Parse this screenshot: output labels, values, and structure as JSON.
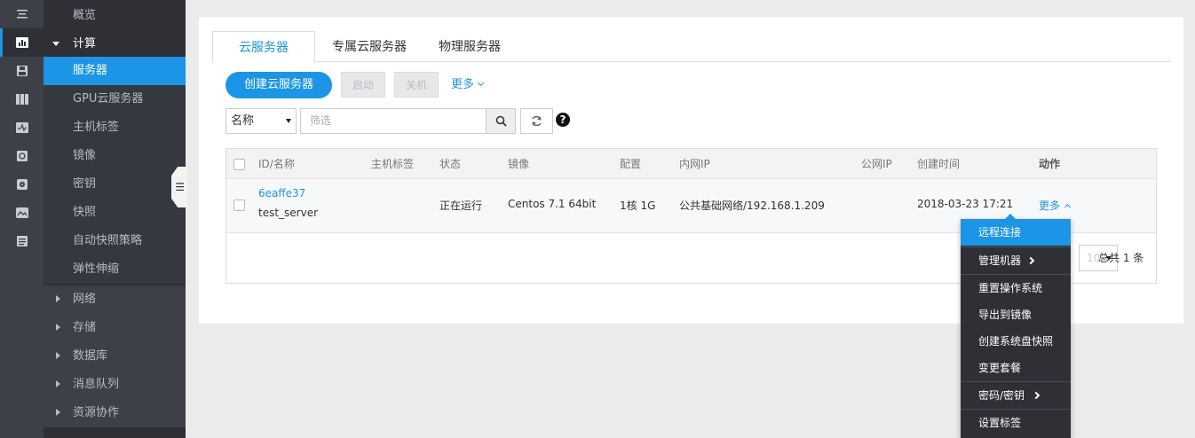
{
  "rail": {
    "icons": [
      "menu-icon",
      "dashboard-icon",
      "save-icon",
      "table-icon",
      "monitor-icon",
      "refresh-box-icon",
      "disk-icon",
      "image-icon",
      "list-icon"
    ]
  },
  "submenu": {
    "overview": "概览",
    "compute_group": "计算",
    "compute_items": [
      "服务器",
      "GPU云服务器",
      "主机标签",
      "镜像",
      "密钥",
      "快照",
      "自动快照策略",
      "弹性伸缩"
    ],
    "collapsed_groups": [
      "网络",
      "存储",
      "数据库",
      "消息队列",
      "资源协作"
    ]
  },
  "tabs": [
    "云服务器",
    "专属云服务器",
    "物理服务器"
  ],
  "toolbar": {
    "create_label": "创建云服务器",
    "start_label": "启动",
    "shutdown_label": "关机",
    "more_label": "更多"
  },
  "filter": {
    "select_value": "名称",
    "search_placeholder": "筛选"
  },
  "table": {
    "columns": [
      "ID/名称",
      "主机标签",
      "状态",
      "镜像",
      "配置",
      "内网IP",
      "公网IP",
      "创建时间",
      "动作"
    ],
    "rows": [
      {
        "id": "6eaffe37",
        "name": "test_server",
        "host_tag": "",
        "status": "正在运行",
        "image": "Centos 7.1 64bit",
        "config": "1核 1G",
        "private_ip": "公共基础网络/192.168.1.209",
        "public_ip": "",
        "created": "2018-03-23 17:21",
        "action": "更多"
      }
    ]
  },
  "pager": {
    "page_size": "10",
    "total": "总共 1 条"
  },
  "action_menu": {
    "items": [
      "远程连接",
      "管理机器",
      "重置操作系统",
      "导出到镜像",
      "创建系统盘快照",
      "变更套餐",
      "密码/密钥",
      "设置标签"
    ]
  },
  "colors": {
    "accent": "#1c95e6",
    "sidebar_dark": "#2e3035",
    "rail": "#3d4046"
  }
}
